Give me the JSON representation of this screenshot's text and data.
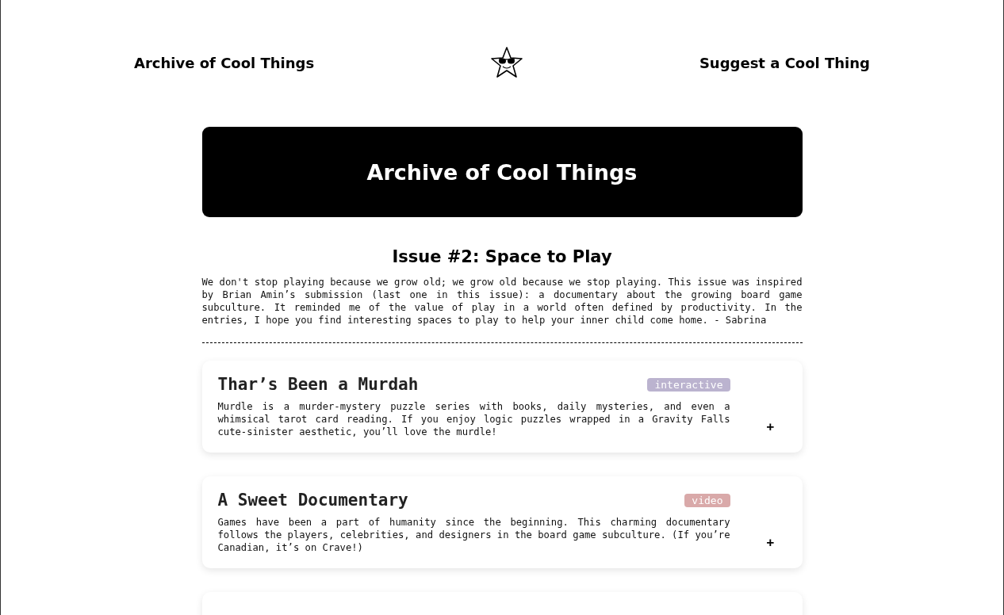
{
  "nav": {
    "home_link": "Archive of Cool Things",
    "suggest_link": "Suggest a Cool Thing"
  },
  "banner": {
    "title": "Archive of Cool Things"
  },
  "issue": {
    "title": "Issue #2: Space to Play",
    "intro": "We don't stop playing because we grow old; we grow old because we stop playing. This issue was inspired by Brian Amin’s submission (last one in this issue): a documentary about the growing board game subculture. It reminded me of the value of play in a world often defined by productivity. In the entries, I hope you find interesting spaces to play to help your inner child come home. - Sabrina"
  },
  "entries": [
    {
      "title": "Thar’s Been a Murdah",
      "tag": "interactive",
      "color": "#bbb3cf",
      "description": "Murdle is a murder-mystery puzzle series with books, daily mysteries, and even a whimsical tarot card reading. If you enjoy logic puzzles wrapped in a Gravity Falls cute-sinister aesthetic, you’ll love the murdle!",
      "toggle": "+"
    },
    {
      "title": "A Sweet Documentary",
      "tag": "video",
      "color": "#d9a9a9",
      "description": "Games have been a part of humanity since the beginning. This charming documentary follows the players, celebrities, and designers in the board game subculture. (If you’re Canadian, it’s on Crave!)",
      "toggle": "+"
    }
  ]
}
